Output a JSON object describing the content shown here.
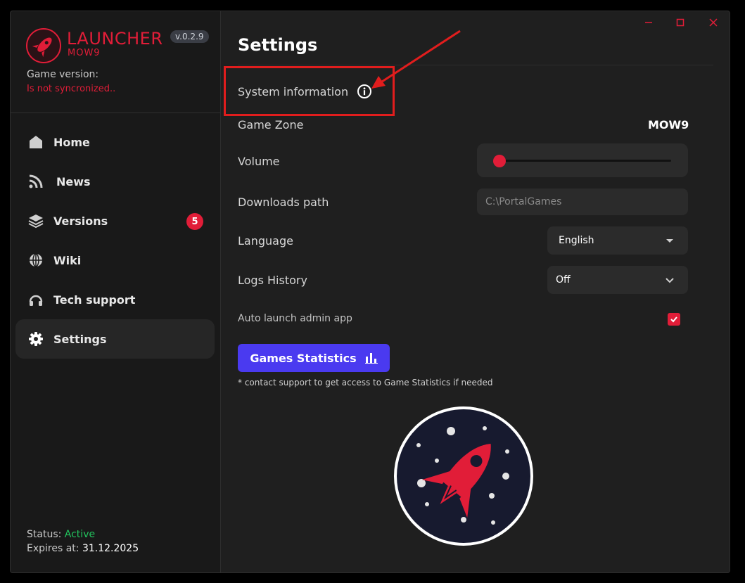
{
  "brand": {
    "name": "LAUNCHER",
    "sub": "MOW9",
    "version": "v.0.2.9"
  },
  "game_version": {
    "label": "Game version:",
    "value": "Is not syncronized.."
  },
  "nav": [
    {
      "label": "Home",
      "icon": "home-icon"
    },
    {
      "label": "News",
      "icon": "rss-icon"
    },
    {
      "label": "Versions",
      "icon": "layers-icon",
      "badge": "5"
    },
    {
      "label": "Wiki",
      "icon": "globe-icon"
    },
    {
      "label": "Tech support",
      "icon": "headphones-icon"
    },
    {
      "label": "Settings",
      "icon": "gear-icon",
      "active": true
    }
  ],
  "status": {
    "label": "Status:",
    "value": "Active",
    "expires_label": "Expires at:",
    "expires_value": "31.12.2025"
  },
  "settings": {
    "title": "Settings",
    "system_info_label": "System information",
    "game_zone_label": "Game Zone",
    "game_zone_value": "MOW9",
    "volume_label": "Volume",
    "volume_level": 0.03,
    "downloads_label": "Downloads path",
    "downloads_value": "C:\\PortalGames",
    "language_label": "Language",
    "language_value": "English",
    "logs_label": "Logs History",
    "logs_value": "Off",
    "autolaunch_label": "Auto launch admin app",
    "autolaunch_checked": true,
    "stats_button": "Games Statistics",
    "stats_note": "* contact support to get access to Game Statistics if needed"
  },
  "colors": {
    "accent": "#e11d38",
    "button": "#4a3af0",
    "active": "#22c55e"
  }
}
